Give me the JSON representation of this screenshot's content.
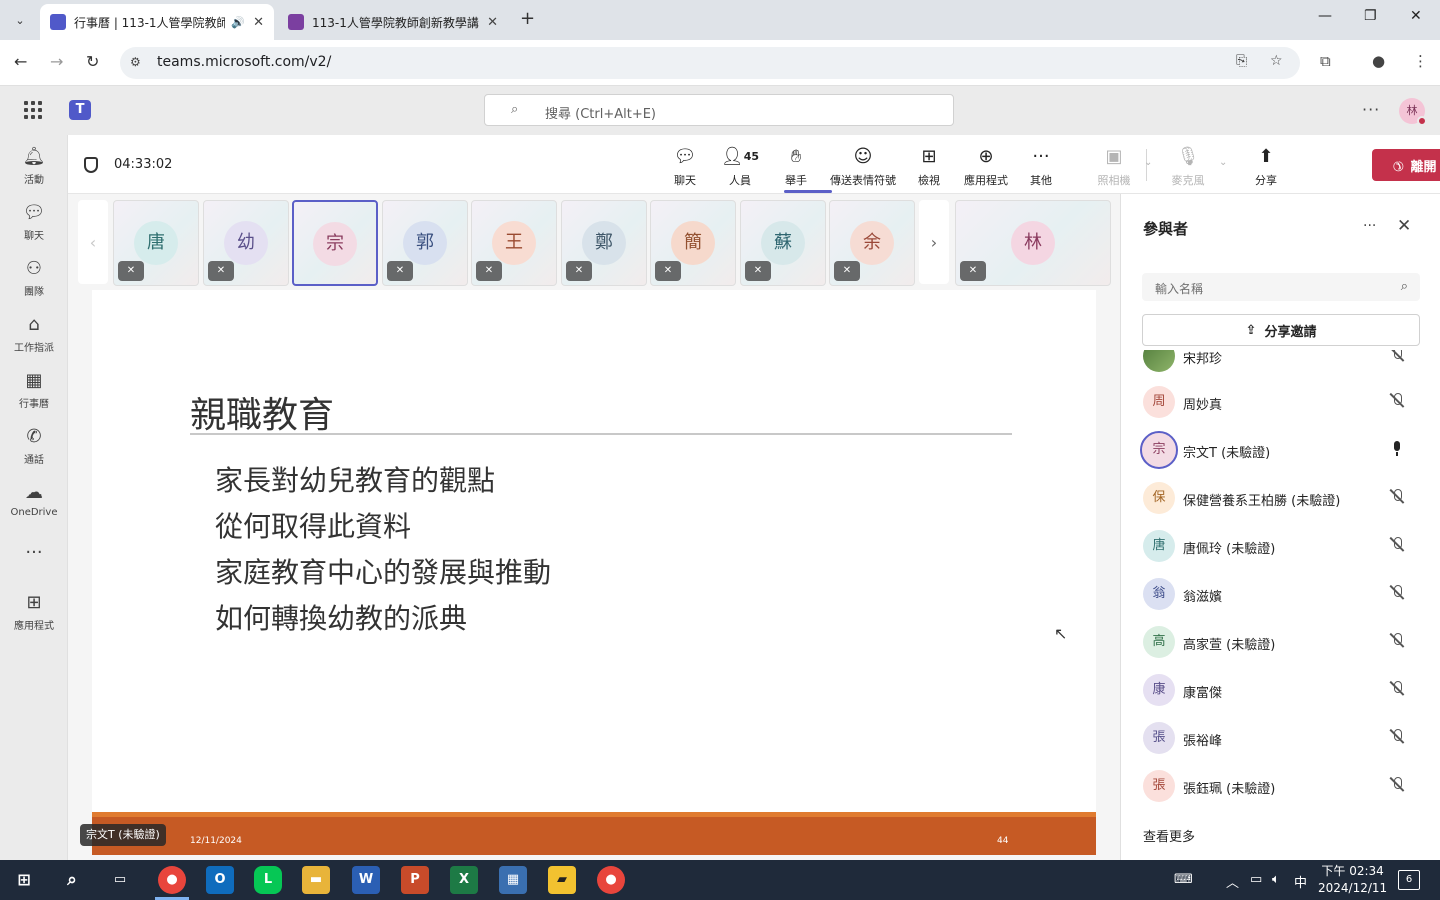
{
  "browser": {
    "tabs": [
      {
        "title": "行事曆 | 113-1人管學院教師",
        "active": true
      },
      {
        "title": "113-1人管學院教師創新教學講",
        "active": false
      }
    ],
    "url": "teams.microsoft.com/v2/"
  },
  "teams": {
    "search_placeholder": "搜尋 (Ctrl+Alt+E)",
    "user_initial": "林",
    "rail": [
      {
        "label": "活動",
        "icon": "bell-icon"
      },
      {
        "label": "聊天",
        "icon": "chat-icon"
      },
      {
        "label": "團隊",
        "icon": "teams-icon"
      },
      {
        "label": "工作指派",
        "icon": "backpack-icon"
      },
      {
        "label": "行事曆",
        "icon": "calendar-icon"
      },
      {
        "label": "通話",
        "icon": "phone-icon"
      },
      {
        "label": "OneDrive",
        "icon": "cloud-icon"
      },
      {
        "label": "應用程式",
        "icon": "add-apps-icon"
      }
    ]
  },
  "meeting": {
    "timer": "04:33:02",
    "people_count": "45",
    "toolbar": {
      "chat": "聊天",
      "people": "人員",
      "raise": "舉手",
      "react": "傳送表情符號",
      "view": "檢視",
      "apps": "應用程式",
      "more": "其他",
      "camera": "照相機",
      "mic": "麥克風",
      "share": "分享",
      "leave": "離開"
    },
    "tiles": [
      "唐",
      "幼",
      "宗",
      "郭",
      "王",
      "鄭",
      "簡",
      "蘇",
      "余"
    ],
    "tile_pinned": "林",
    "presenter": "宗文T (未驗證)"
  },
  "slide": {
    "title": "親職教育",
    "bullets": [
      "家長對幼兒教育的觀點",
      "從何取得此資料",
      "家庭教育中心的發展與推動",
      "如何轉換幼教的派典"
    ],
    "date": "12/11/2024",
    "page": "44"
  },
  "panel": {
    "title": "參與者",
    "search_placeholder": "輸入名稱",
    "share_invite": "分享邀請",
    "participants": [
      {
        "initial": "",
        "name": "宋邦珍",
        "mic": "muted"
      },
      {
        "initial": "周",
        "name": "周妙真",
        "mic": "muted"
      },
      {
        "initial": "宗",
        "name": "宗文T (未驗證)",
        "mic": "on"
      },
      {
        "initial": "保",
        "name": "保健營養系王柏勝 (未驗證)",
        "mic": "muted"
      },
      {
        "initial": "唐",
        "name": "唐佩玲 (未驗證)",
        "mic": "muted"
      },
      {
        "initial": "翁",
        "name": "翁滋嬪",
        "mic": "muted"
      },
      {
        "initial": "高",
        "name": "高家萱 (未驗證)",
        "mic": "muted"
      },
      {
        "initial": "康",
        "name": "康富傑",
        "mic": "muted"
      },
      {
        "initial": "張",
        "name": "張裕峰",
        "mic": "muted"
      },
      {
        "initial": "張",
        "name": "張鈺珮 (未驗證)",
        "mic": "muted"
      }
    ],
    "see_more": "查看更多"
  },
  "taskbar": {
    "ime": "中",
    "time": "下午 02:34",
    "date": "2024/12/11",
    "notifications": "6"
  }
}
